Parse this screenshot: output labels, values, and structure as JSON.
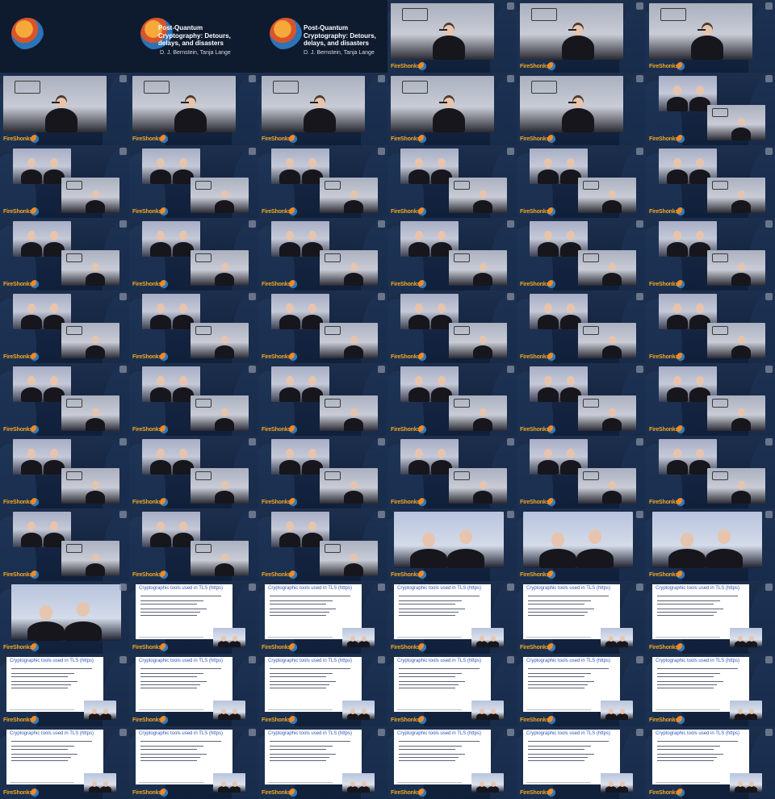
{
  "sheet": {
    "columns": 6,
    "rows": 11
  },
  "title_slide": {
    "line1": "Post-Quantum",
    "line2": "Cryptography: Detours,",
    "line3": "delays, and disasters",
    "authors": "D. J. Bernstein, Tanja Lange"
  },
  "brand": {
    "name": "FireShonks",
    "accent_color": "#f5a623"
  },
  "slide": {
    "title": "Cryptographic tools used in TLS (https)"
  },
  "tiles": [
    "title",
    "title",
    "title",
    "speaker",
    "speaker",
    "speaker",
    "speaker",
    "speaker",
    "speaker",
    "speaker",
    "speaker",
    "duo-pip",
    "duo-pip",
    "duo-pip",
    "duo-pip",
    "duo-pip",
    "duo-pip",
    "duo-pip",
    "duo-pip",
    "duo-pip",
    "duo-pip",
    "duo-pip",
    "duo-pip",
    "duo-pip",
    "duo-pip",
    "duo-pip",
    "duo-pip",
    "duo-pip",
    "duo-pip",
    "duo-pip",
    "duo-pip",
    "duo-pip",
    "duo-pip",
    "duo-pip",
    "duo-pip",
    "duo-pip",
    "duo-pip",
    "duo-pip",
    "duo-pip",
    "duo-pip",
    "duo-pip",
    "duo-pip",
    "duo-pip",
    "duo-pip",
    "duo-pip",
    "duo-close",
    "duo-close",
    "duo-close",
    "duo-close",
    "slide",
    "slide",
    "slide",
    "slide",
    "slide",
    "slide",
    "slide",
    "slide",
    "slide",
    "slide",
    "slide",
    "slide",
    "slide",
    "slide",
    "slide",
    "slide",
    "slide"
  ]
}
